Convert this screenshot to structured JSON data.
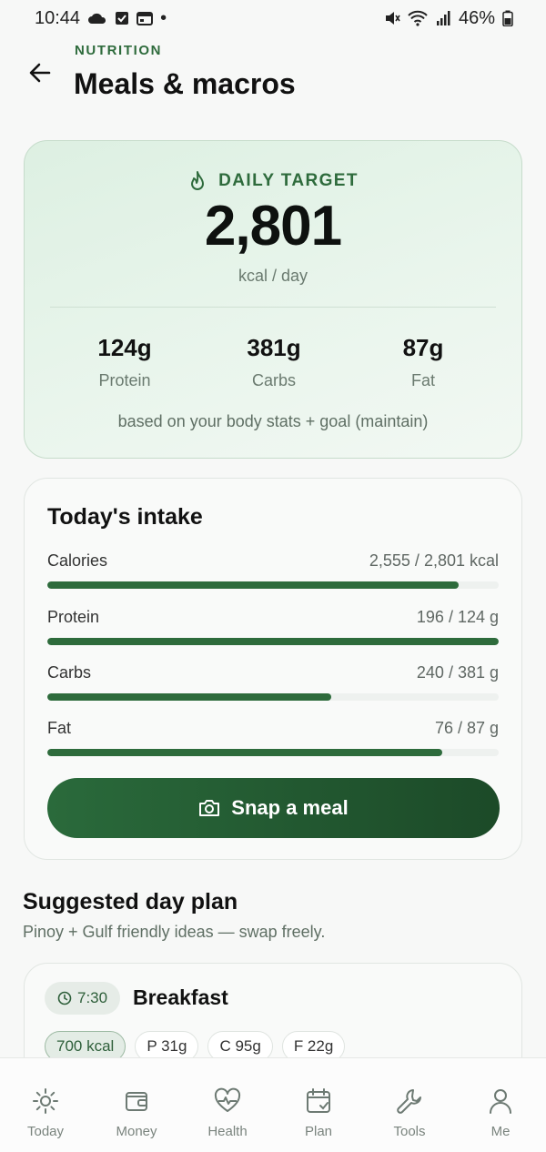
{
  "status_bar": {
    "time": "10:44",
    "dot": "•",
    "battery": "46%"
  },
  "header": {
    "overline": "NUTRITION",
    "title": "Meals & macros"
  },
  "daily_target": {
    "label": "DAILY TARGET",
    "value": "2,801",
    "unit": "kcal / day",
    "macros": [
      {
        "value": "124g",
        "label": "Protein"
      },
      {
        "value": "381g",
        "label": "Carbs"
      },
      {
        "value": "87g",
        "label": "Fat"
      }
    ],
    "note": "based on your body stats + goal (maintain)"
  },
  "intake": {
    "title": "Today's intake",
    "rows": [
      {
        "label": "Calories",
        "value": "2,555 / 2,801 kcal",
        "fraction": 0.912
      },
      {
        "label": "Protein",
        "value": "196 / 124 g",
        "fraction": 1.0
      },
      {
        "label": "Carbs",
        "value": "240 / 381 g",
        "fraction": 0.63
      },
      {
        "label": "Fat",
        "value": "76 / 87 g",
        "fraction": 0.874
      }
    ],
    "snap_label": "Snap a meal"
  },
  "plan": {
    "title": "Suggested day plan",
    "subtitle": "Pinoy + Gulf friendly ideas — swap freely.",
    "meal": {
      "time": "7:30",
      "name": "Breakfast",
      "chips": [
        "700 kcal",
        "P 31g",
        "C 95g",
        "F 22g"
      ]
    }
  },
  "nav": {
    "items": [
      {
        "label": "Today",
        "icon": "sun-icon"
      },
      {
        "label": "Money",
        "icon": "wallet-icon"
      },
      {
        "label": "Health",
        "icon": "heart-pulse-icon"
      },
      {
        "label": "Plan",
        "icon": "calendar-check-icon"
      },
      {
        "label": "Tools",
        "icon": "wrench-icon"
      },
      {
        "label": "Me",
        "icon": "person-icon"
      }
    ]
  },
  "colors": {
    "accent": "#2e6b3c",
    "accent_dark": "#1c4a28",
    "card_tint": "#e3f2e7"
  }
}
